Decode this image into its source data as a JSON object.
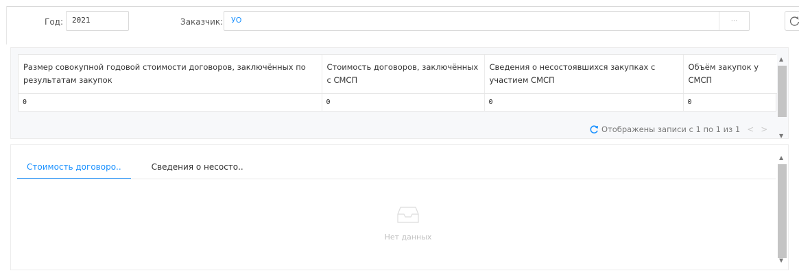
{
  "filters": {
    "year_label": "Год:",
    "year_value": "2021",
    "customer_label": "Заказчик:",
    "customer_value": "УО",
    "customer_picker": "..."
  },
  "summary_table": {
    "columns": [
      "Размер совокупной годовой стоимости договоров, заключённых по результатам закупок",
      "Стоимость договоров, заключённых с СМСП",
      "Сведения о несостоявшихся закупках с участием СМСП",
      "Объём закупок у СМСП"
    ],
    "rows": [
      [
        "0",
        "0",
        "0",
        "0"
      ]
    ]
  },
  "pager": {
    "text": "Отображены записи с 1 по 1 из 1",
    "prev": "<",
    "next": ">"
  },
  "tabs": [
    {
      "label": "Стоимость договоро..",
      "active": true
    },
    {
      "label": "Сведения о несосто..",
      "active": false
    }
  ],
  "empty_state": {
    "text": "Нет данных",
    "icon": "inbox-icon"
  },
  "colors": {
    "accent": "#1890ff",
    "border": "#d9d9d9"
  }
}
